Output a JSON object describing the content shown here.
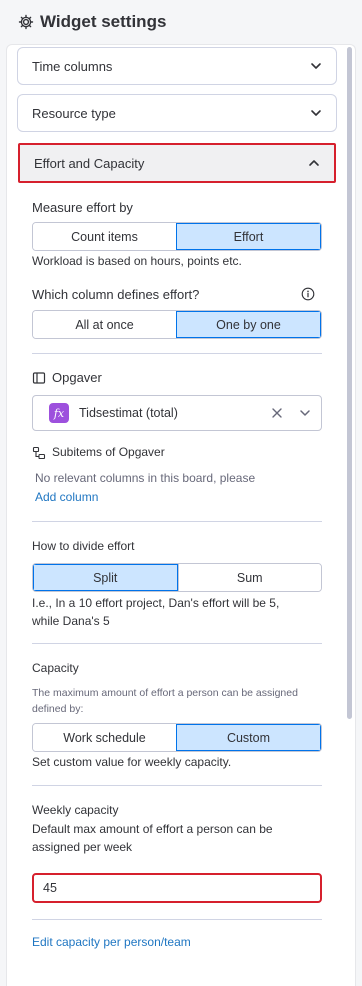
{
  "header": {
    "title": "Widget settings"
  },
  "accordions": {
    "time_columns": "Time columns",
    "resource_type": "Resource type",
    "effort_capacity": "Effort and Capacity"
  },
  "measure": {
    "label": "Measure effort by",
    "options": [
      "Count items",
      "Effort"
    ],
    "selected": "Effort",
    "help": "Workload is based on hours, points etc."
  },
  "which_column": {
    "label": "Which column defines effort?",
    "options": [
      "All at once",
      "One by one"
    ],
    "selected": "One by one"
  },
  "board": {
    "name": "Opgaver",
    "column_value": "Tidsestimat (total)",
    "fx_glyph": "fx"
  },
  "subitems": {
    "label": "Subitems of Opgaver",
    "message": "No relevant columns in this board, please",
    "add_link": "Add column"
  },
  "divide": {
    "label": "How to divide effort",
    "options": [
      "Split",
      "Sum"
    ],
    "selected": "Split",
    "help_line1": "I.e., In a 10 effort project, Dan's effort will be 5,",
    "help_line2": "while Dana's 5"
  },
  "capacity": {
    "label": "Capacity",
    "desc_line1": "The maximum amount of effort a person can be assigned",
    "desc_line2": "defined by:",
    "options": [
      "Work schedule",
      "Custom"
    ],
    "selected": "Custom",
    "help": "Set custom value for weekly capacity."
  },
  "weekly": {
    "label": "Weekly capacity",
    "desc_line1": "Default max amount of effort a person can be",
    "desc_line2": "assigned per week",
    "value": "45"
  },
  "edit_link": "Edit capacity per person/team",
  "colors": {
    "accent": "#0073ea",
    "selected_bg": "#cce5ff",
    "highlight": "#d6202d",
    "link": "#1f76c2",
    "formula_badge": "#9d50dd"
  }
}
